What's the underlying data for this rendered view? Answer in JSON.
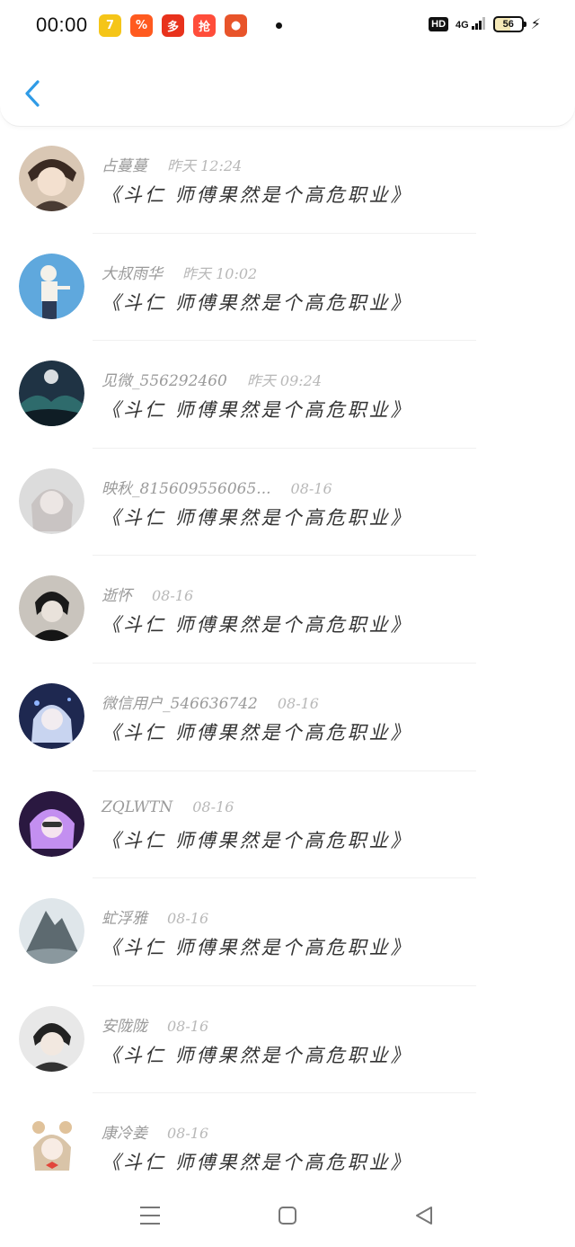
{
  "status_bar": {
    "time": "00:00",
    "app_icons": [
      {
        "name": "tencent-video-icon",
        "glyph": "7",
        "color": "#f5c518"
      },
      {
        "name": "coupon-app-icon",
        "glyph": "%",
        "color": "#ff5a1f"
      },
      {
        "name": "pinduoduo-icon",
        "glyph": "多",
        "color": "#e8321c"
      },
      {
        "name": "shopping-app-icon",
        "glyph": "抢",
        "color": "#ff4d3a"
      },
      {
        "name": "pumpkin-app-icon",
        "glyph": "●",
        "color": "#e8542a"
      }
    ],
    "hd_label": "HD",
    "network_label": "4G",
    "battery_level": "56"
  },
  "header": {
    "back_icon": "chevron-left-icon",
    "accent_color": "#2f9be6"
  },
  "comments": [
    {
      "user": "占蔓蔓",
      "time": "昨天 12:24",
      "text": "《斗仁 师傅果然是个高危职业》",
      "avatar": "avatar-boy-anime"
    },
    {
      "user": "大叔雨华",
      "time": "昨天 10:02",
      "text": "《斗仁 师傅果然是个高危职业》",
      "avatar": "avatar-sketch-figure"
    },
    {
      "user": "见微_556292460",
      "time": "昨天 09:24",
      "text": "《斗仁 师傅果然是个高危职业》",
      "avatar": "avatar-moon-landscape"
    },
    {
      "user": "映秋_8156095560​65...",
      "time": "08-16",
      "text": "《斗仁 师傅果然是个高危职业》",
      "avatar": "avatar-pale-girl"
    },
    {
      "user": "逝怀",
      "time": "08-16",
      "text": "《斗仁 师傅果然是个高危职业》",
      "avatar": "avatar-dark-boy"
    },
    {
      "user": "微信用户_546636742",
      "time": "08-16",
      "text": "《斗仁 师傅果然是个高危职业》",
      "avatar": "avatar-blue-girl"
    },
    {
      "user": "ZQLWTN",
      "time": "08-16",
      "text": "《斗仁 师傅果然是个高危职业》",
      "avatar": "avatar-purple-girl"
    },
    {
      "user": "虻浮雅",
      "time": "08-16",
      "text": "《斗仁 师傅果然是个高危职业》",
      "avatar": "avatar-mountain"
    },
    {
      "user": "安陇陇",
      "time": "08-16",
      "text": "《斗仁 师傅果然是个高危职业》",
      "avatar": "avatar-boy-dark-hair"
    },
    {
      "user": "康冷姜",
      "time": "08-16",
      "text": "《斗仁 师傅果然是个高危职业》",
      "avatar": "avatar-bear-girl"
    }
  ],
  "nav_bar": {
    "menu_icon": "menu-icon",
    "home_icon": "home-square-icon",
    "back_icon": "back-triangle-icon"
  }
}
